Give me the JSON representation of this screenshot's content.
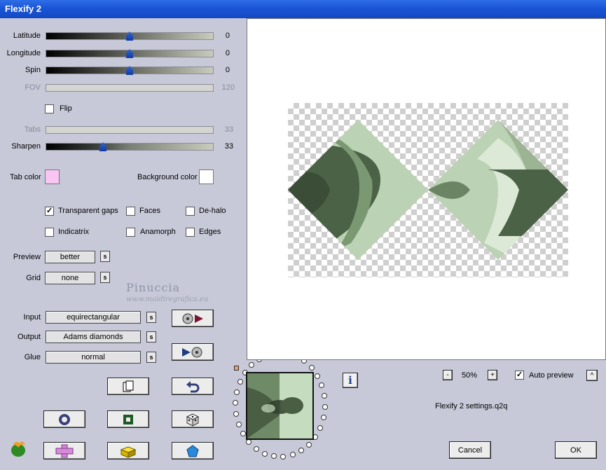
{
  "window": {
    "title": "Flexify 2"
  },
  "sliders": [
    {
      "label": "Latitude",
      "value": "0",
      "fraction": 0.5,
      "enabled": true
    },
    {
      "label": "Longitude",
      "value": "0",
      "fraction": 0.5,
      "enabled": true
    },
    {
      "label": "Spin",
      "value": "0",
      "fraction": 0.5,
      "enabled": true
    },
    {
      "label": "FOV",
      "value": "120",
      "enabled": false
    },
    {
      "label": "Tabs",
      "value": "33",
      "enabled": false
    },
    {
      "label": "Sharpen",
      "value": "33",
      "fraction": 0.33,
      "enabled": true
    }
  ],
  "flip": {
    "label": "Flip",
    "checked": false
  },
  "colors": {
    "tab_color_label": "Tab color",
    "tab_color": "#f9c6f3",
    "background_color_label": "Background color",
    "background_color": "#ffffff"
  },
  "options": [
    {
      "label": "Transparent gaps",
      "checked": true
    },
    {
      "label": "Faces",
      "checked": false
    },
    {
      "label": "De-halo",
      "checked": false
    },
    {
      "label": "Indicatrix",
      "checked": false
    },
    {
      "label": "Anamorph",
      "checked": false
    },
    {
      "label": "Edges",
      "checked": false
    }
  ],
  "preview_quality": {
    "label": "Preview",
    "value": "better",
    "s": "s"
  },
  "grid": {
    "label": "Grid",
    "value": "none",
    "s": "s"
  },
  "watermark": {
    "name": "Pinuccia",
    "url": "www.maidiregrafica.eu"
  },
  "projection": {
    "input_label": "Input",
    "input_value": "equirectangular",
    "output_label": "Output",
    "output_value": "Adams diamonds",
    "glue_label": "Glue",
    "glue_value": "normal",
    "s": "s"
  },
  "zoom": {
    "minus": "-",
    "value": "50%",
    "plus": "+"
  },
  "auto_preview": {
    "label": "Auto preview",
    "checked": true,
    "toggle": "^"
  },
  "settings_file": "Flexify 2 settings.q2q",
  "info_glyph": "i",
  "buttons": {
    "cancel": "Cancel",
    "ok": "OK"
  },
  "accent": {
    "title_blue": "#1a55d6",
    "shape_dark": "#4c6246",
    "shape_light": "#bcd2b4"
  }
}
